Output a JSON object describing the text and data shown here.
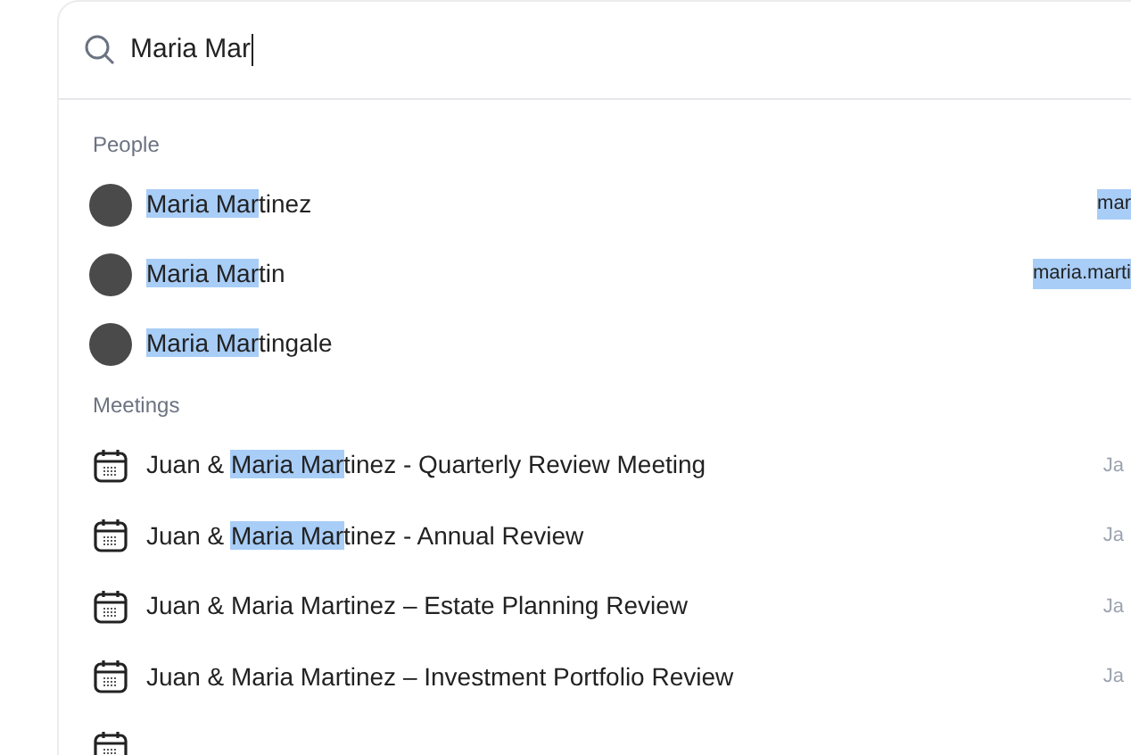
{
  "search": {
    "value": "Maria Mar"
  },
  "people": {
    "heading": "People",
    "items": [
      {
        "name": [
          {
            "text": "Maria Mar",
            "highlight": true
          },
          {
            "text": "tinez",
            "highlight": false
          }
        ],
        "email": "mar"
      },
      {
        "name": [
          {
            "text": "Maria Mar",
            "highlight": true
          },
          {
            "text": "tin",
            "highlight": false
          }
        ],
        "email": "maria.marti"
      },
      {
        "name": [
          {
            "text": "Maria Mar",
            "highlight": true
          },
          {
            "text": "tingale",
            "highlight": false
          }
        ]
      }
    ]
  },
  "meetings": {
    "heading": "Meetings",
    "items": [
      {
        "title": [
          {
            "text": "Juan & ",
            "highlight": false
          },
          {
            "text": "Maria Mar",
            "highlight": true
          },
          {
            "text": "tinez - Quarterly Review Meeting",
            "highlight": false
          }
        ],
        "date": "Ja"
      },
      {
        "title": [
          {
            "text": "Juan & ",
            "highlight": false
          },
          {
            "text": "Maria Mar",
            "highlight": true
          },
          {
            "text": "tinez - Annual Review",
            "highlight": false
          }
        ],
        "date": "Ja"
      },
      {
        "title": [
          {
            "text": "Juan & Maria Martinez – Estate Planning Review",
            "highlight": false
          }
        ],
        "date": "Ja"
      },
      {
        "title": [
          {
            "text": "Juan & Maria Martinez – Investment Portfolio Review",
            "highlight": false
          }
        ],
        "date": "Ja"
      }
    ],
    "more_below": true
  }
}
